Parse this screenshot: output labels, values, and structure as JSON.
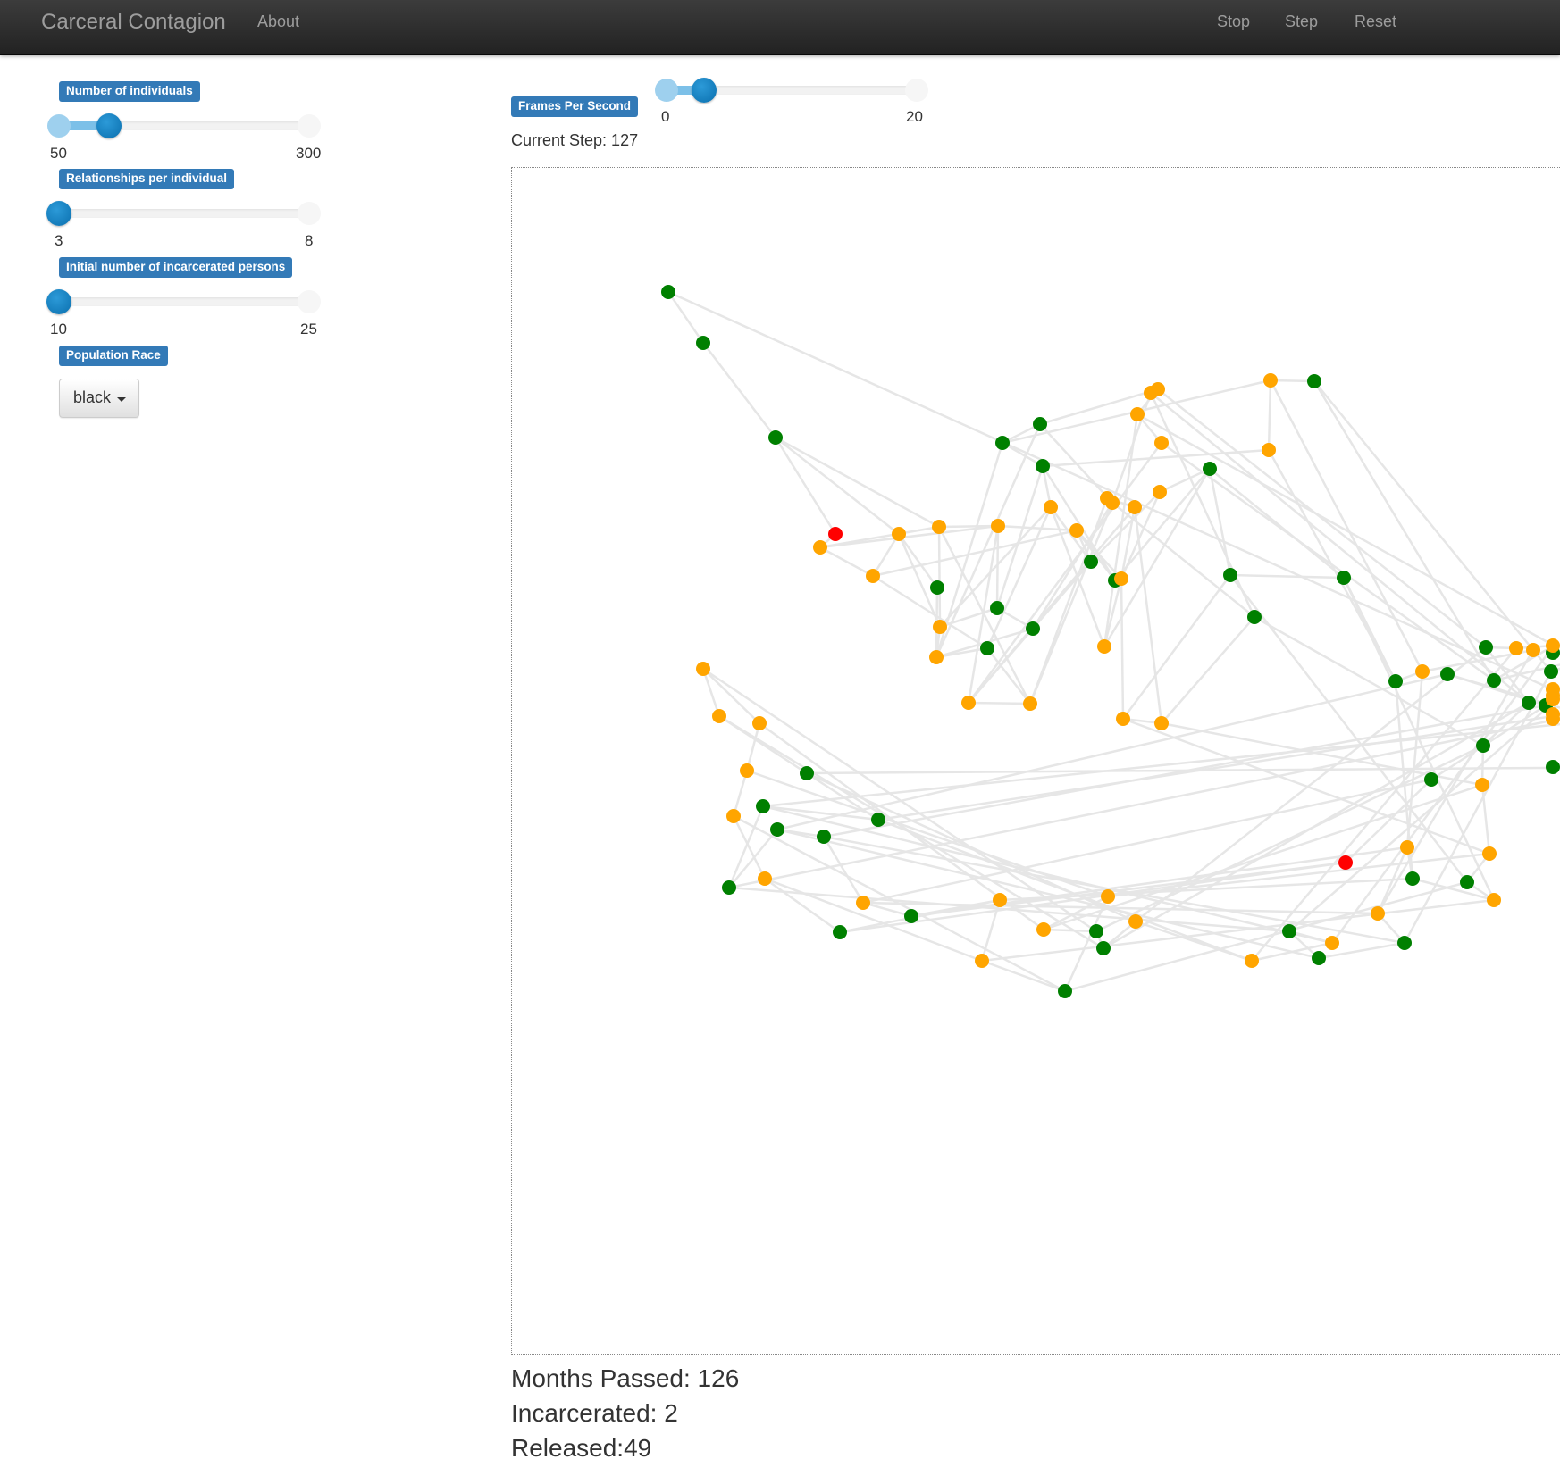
{
  "navbar": {
    "brand": "Carceral Contagion",
    "about": "About",
    "stop": "Stop",
    "step": "Step",
    "reset": "Reset"
  },
  "controls": {
    "individuals": {
      "label": "Number of individuals",
      "min": "50",
      "max": "300",
      "value": 100
    },
    "relationships": {
      "label": "Relationships per individual",
      "min": "3",
      "max": "8",
      "value": 3
    },
    "incarcerated": {
      "label": "Initial number of incarcerated persons",
      "min": "10",
      "max": "25",
      "value": 10
    },
    "race": {
      "label": "Population Race",
      "selected": "black"
    },
    "fps": {
      "label": "Frames Per Second",
      "min": "0",
      "max": "20",
      "value": 3
    }
  },
  "status": {
    "current_step": "Current Step: 127",
    "months_passed": "Months Passed: 126",
    "incarcerated": "Incarcerated: 2",
    "released": "Released:49"
  },
  "network": {
    "colors": {
      "never": "#008000",
      "released": "#ffa500",
      "incarcerated": "#ff0000",
      "edge": "#e6e6e6"
    },
    "nodes": [
      {
        "id": "n1",
        "s": "never"
      },
      {
        "id": "n2",
        "s": "never"
      },
      {
        "id": "n3",
        "s": "never"
      },
      {
        "id": "n4",
        "s": "incarcerated"
      },
      {
        "id": "n5",
        "s": "released"
      },
      {
        "id": "n6",
        "s": "released"
      },
      {
        "id": "n7",
        "s": "released"
      },
      {
        "id": "n8",
        "s": "released"
      },
      {
        "id": "n9",
        "s": "never"
      },
      {
        "id": "n10",
        "s": "released"
      },
      {
        "id": "n11",
        "s": "released"
      },
      {
        "id": "n12",
        "s": "never"
      },
      {
        "id": "n13",
        "s": "never"
      },
      {
        "id": "n14",
        "s": "released"
      },
      {
        "id": "n15",
        "s": "never"
      },
      {
        "id": "n16",
        "s": "released"
      },
      {
        "id": "n17",
        "s": "released"
      },
      {
        "id": "n18",
        "s": "never"
      },
      {
        "id": "n19",
        "s": "released"
      },
      {
        "id": "n20",
        "s": "never"
      },
      {
        "id": "n21",
        "s": "released"
      },
      {
        "id": "n22",
        "s": "never"
      },
      {
        "id": "n23",
        "s": "never"
      },
      {
        "id": "n24",
        "s": "never"
      },
      {
        "id": "n25",
        "s": "released"
      },
      {
        "id": "n26",
        "s": "released"
      },
      {
        "id": "n27",
        "s": "released"
      },
      {
        "id": "n28",
        "s": "released"
      },
      {
        "id": "n29",
        "s": "released"
      },
      {
        "id": "n30",
        "s": "released"
      },
      {
        "id": "n31",
        "s": "never"
      },
      {
        "id": "n32",
        "s": "released"
      },
      {
        "id": "n33",
        "s": "released"
      },
      {
        "id": "n34",
        "s": "never"
      },
      {
        "id": "n35",
        "s": "released"
      },
      {
        "id": "n36",
        "s": "released"
      },
      {
        "id": "n37",
        "s": "released"
      },
      {
        "id": "n38",
        "s": "released"
      },
      {
        "id": "n39",
        "s": "never"
      },
      {
        "id": "n40",
        "s": "released"
      },
      {
        "id": "n41",
        "s": "released"
      },
      {
        "id": "n42",
        "s": "never"
      },
      {
        "id": "n43",
        "s": "never"
      },
      {
        "id": "n44",
        "s": "never"
      },
      {
        "id": "n45",
        "s": "released"
      },
      {
        "id": "n46",
        "s": "released"
      },
      {
        "id": "n47",
        "s": "never"
      },
      {
        "id": "n48",
        "s": "never"
      },
      {
        "id": "n49",
        "s": "never"
      },
      {
        "id": "n50",
        "s": "released"
      },
      {
        "id": "n51",
        "s": "released"
      },
      {
        "id": "n52",
        "s": "never"
      },
      {
        "id": "n53",
        "s": "never"
      },
      {
        "id": "n54",
        "s": "never"
      },
      {
        "id": "n55",
        "s": "released"
      },
      {
        "id": "n56",
        "s": "released"
      },
      {
        "id": "n57",
        "s": "never"
      },
      {
        "id": "n58",
        "s": "released"
      },
      {
        "id": "n59",
        "s": "never"
      },
      {
        "id": "n60",
        "s": "released"
      },
      {
        "id": "n61",
        "s": "released"
      },
      {
        "id": "n62",
        "s": "never"
      },
      {
        "id": "n63",
        "s": "never"
      },
      {
        "id": "n64",
        "s": "never"
      },
      {
        "id": "n65",
        "s": "released"
      },
      {
        "id": "n66",
        "s": "released"
      },
      {
        "id": "n67",
        "s": "released"
      },
      {
        "id": "n68",
        "s": "never"
      },
      {
        "id": "n69",
        "s": "never"
      },
      {
        "id": "n70",
        "s": "released"
      },
      {
        "id": "n71",
        "s": "released"
      },
      {
        "id": "n72",
        "s": "never"
      },
      {
        "id": "n73",
        "s": "released"
      },
      {
        "id": "n74",
        "s": "released"
      },
      {
        "id": "n75",
        "s": "never"
      },
      {
        "id": "n76",
        "s": "released"
      },
      {
        "id": "n77",
        "s": "never"
      },
      {
        "id": "n78",
        "s": "never"
      },
      {
        "id": "n79",
        "s": "never"
      },
      {
        "id": "n80",
        "s": "never"
      },
      {
        "id": "n81",
        "s": "never"
      },
      {
        "id": "n82",
        "s": "never"
      },
      {
        "id": "n83",
        "s": "released"
      },
      {
        "id": "n84",
        "s": "released"
      },
      {
        "id": "n85",
        "s": "released"
      },
      {
        "id": "n86",
        "s": "released"
      },
      {
        "id": "n87",
        "s": "released"
      },
      {
        "id": "n88",
        "s": "released"
      },
      {
        "id": "n89",
        "s": "never"
      },
      {
        "id": "n90",
        "s": "incarcerated"
      },
      {
        "id": "n91",
        "s": "never"
      },
      {
        "id": "n92",
        "s": "never"
      },
      {
        "id": "n93",
        "s": "never"
      },
      {
        "id": "n94",
        "s": "released"
      },
      {
        "id": "n95",
        "s": "released"
      },
      {
        "id": "n96",
        "s": "released"
      },
      {
        "id": "n97",
        "s": "never"
      },
      {
        "id": "n98",
        "s": "released"
      },
      {
        "id": "n99",
        "s": "released"
      }
    ],
    "edges": [
      [
        "n1",
        "n2"
      ],
      [
        "n2",
        "n3"
      ],
      [
        "n3",
        "n4"
      ],
      [
        "n3",
        "n6"
      ],
      [
        "n3",
        "n8"
      ],
      [
        "n4",
        "n5"
      ],
      [
        "n5",
        "n7"
      ],
      [
        "n5",
        "n10"
      ],
      [
        "n5",
        "n8"
      ],
      [
        "n6",
        "n7"
      ],
      [
        "n6",
        "n11"
      ],
      [
        "n6",
        "n9"
      ],
      [
        "n7",
        "n15"
      ],
      [
        "n7",
        "n19"
      ],
      [
        "n8",
        "n10"
      ],
      [
        "n8",
        "n11"
      ],
      [
        "n8",
        "n16"
      ],
      [
        "n9",
        "n14"
      ],
      [
        "n10",
        "n12"
      ],
      [
        "n10",
        "n17"
      ],
      [
        "n10",
        "n19"
      ],
      [
        "n11",
        "n12"
      ],
      [
        "n11",
        "n14"
      ],
      [
        "n11",
        "n21"
      ],
      [
        "n12",
        "n13"
      ],
      [
        "n12",
        "n22"
      ],
      [
        "n13",
        "n14"
      ],
      [
        "n13",
        "n25"
      ],
      [
        "n14",
        "n15"
      ],
      [
        "n14",
        "n23"
      ],
      [
        "n14",
        "n24"
      ],
      [
        "n15",
        "n16"
      ],
      [
        "n15",
        "n21"
      ],
      [
        "n16",
        "n17"
      ],
      [
        "n16",
        "n26"
      ],
      [
        "n16",
        "n25"
      ],
      [
        "n17",
        "n18"
      ],
      [
        "n17",
        "n27"
      ],
      [
        "n17",
        "n35"
      ],
      [
        "n18",
        "n19"
      ],
      [
        "n18",
        "n21"
      ],
      [
        "n18",
        "n28"
      ],
      [
        "n19",
        "n20"
      ],
      [
        "n19",
        "n29"
      ],
      [
        "n20",
        "n22"
      ],
      [
        "n20",
        "n31"
      ],
      [
        "n21",
        "n22"
      ],
      [
        "n21",
        "n30"
      ],
      [
        "n22",
        "n23"
      ],
      [
        "n22",
        "n32"
      ],
      [
        "n23",
        "n24"
      ],
      [
        "n23",
        "n33"
      ],
      [
        "n24",
        "n37"
      ],
      [
        "n24",
        "n25"
      ],
      [
        "n25",
        "n26"
      ],
      [
        "n25",
        "n38"
      ],
      [
        "n26",
        "n27"
      ],
      [
        "n26",
        "n39"
      ],
      [
        "n27",
        "n40"
      ],
      [
        "n27",
        "n29"
      ],
      [
        "n28",
        "n29"
      ],
      [
        "n28",
        "n31"
      ],
      [
        "n29",
        "n30"
      ],
      [
        "n29",
        "n41"
      ],
      [
        "n30",
        "n31"
      ],
      [
        "n30",
        "n36"
      ],
      [
        "n31",
        "n43"
      ],
      [
        "n31",
        "n42"
      ],
      [
        "n32",
        "n33"
      ],
      [
        "n32",
        "n44"
      ],
      [
        "n33",
        "n34"
      ],
      [
        "n33",
        "n45"
      ],
      [
        "n34",
        "n46"
      ],
      [
        "n34",
        "n49"
      ],
      [
        "n35",
        "n36"
      ],
      [
        "n35",
        "n49"
      ],
      [
        "n36",
        "n37"
      ],
      [
        "n36",
        "n50"
      ],
      [
        "n37",
        "n38"
      ],
      [
        "n37",
        "n52"
      ],
      [
        "n38",
        "n39"
      ],
      [
        "n38",
        "n53"
      ],
      [
        "n39",
        "n40"
      ],
      [
        "n39",
        "n54"
      ],
      [
        "n40",
        "n41"
      ],
      [
        "n40",
        "n55"
      ],
      [
        "n41",
        "n42"
      ],
      [
        "n41",
        "n56"
      ],
      [
        "n42",
        "n43"
      ],
      [
        "n42",
        "n57"
      ],
      [
        "n43",
        "n44"
      ],
      [
        "n43",
        "n58"
      ],
      [
        "n44",
        "n45"
      ],
      [
        "n44",
        "n59"
      ],
      [
        "n45",
        "n46"
      ],
      [
        "n45",
        "n60"
      ],
      [
        "n46",
        "n47"
      ],
      [
        "n46",
        "n61"
      ],
      [
        "n47",
        "n48"
      ],
      [
        "n47",
        "n62"
      ],
      [
        "n48",
        "n49"
      ],
      [
        "n48",
        "n64"
      ],
      [
        "n49",
        "n50"
      ],
      [
        "n50",
        "n51"
      ],
      [
        "n50",
        "n65"
      ],
      [
        "n51",
        "n52"
      ],
      [
        "n51",
        "n66"
      ],
      [
        "n52",
        "n53"
      ],
      [
        "n52",
        "n67"
      ],
      [
        "n53",
        "n54"
      ],
      [
        "n53",
        "n68"
      ],
      [
        "n54",
        "n55"
      ],
      [
        "n54",
        "n69"
      ],
      [
        "n55",
        "n56"
      ],
      [
        "n55",
        "n70"
      ],
      [
        "n56",
        "n57"
      ],
      [
        "n56",
        "n71"
      ],
      [
        "n57",
        "n58"
      ],
      [
        "n57",
        "n72"
      ],
      [
        "n58",
        "n59"
      ],
      [
        "n58",
        "n73"
      ],
      [
        "n59",
        "n60"
      ],
      [
        "n59",
        "n74"
      ],
      [
        "n60",
        "n61"
      ],
      [
        "n60",
        "n75"
      ],
      [
        "n61",
        "n62"
      ],
      [
        "n61",
        "n76"
      ],
      [
        "n62",
        "n63"
      ],
      [
        "n62",
        "n77"
      ],
      [
        "n63",
        "n64"
      ],
      [
        "n63",
        "n78"
      ],
      [
        "n64",
        "n65"
      ],
      [
        "n64",
        "n79"
      ],
      [
        "n65",
        "n66"
      ],
      [
        "n65",
        "n80"
      ],
      [
        "n66",
        "n67"
      ],
      [
        "n66",
        "n81"
      ],
      [
        "n67",
        "n68"
      ],
      [
        "n67",
        "n82"
      ],
      [
        "n68",
        "n69"
      ],
      [
        "n68",
        "n83"
      ],
      [
        "n69",
        "n70"
      ],
      [
        "n69",
        "n84"
      ],
      [
        "n70",
        "n71"
      ],
      [
        "n70",
        "n85"
      ],
      [
        "n71",
        "n72"
      ],
      [
        "n71",
        "n86"
      ],
      [
        "n72",
        "n73"
      ],
      [
        "n72",
        "n87"
      ],
      [
        "n73",
        "n74"
      ],
      [
        "n73",
        "n88"
      ],
      [
        "n74",
        "n75"
      ],
      [
        "n74",
        "n89"
      ],
      [
        "n75",
        "n76"
      ],
      [
        "n75",
        "n90"
      ],
      [
        "n76",
        "n77"
      ],
      [
        "n76",
        "n91"
      ],
      [
        "n77",
        "n78"
      ],
      [
        "n77",
        "n92"
      ],
      [
        "n78",
        "n79"
      ],
      [
        "n78",
        "n93"
      ],
      [
        "n79",
        "n80"
      ],
      [
        "n79",
        "n94"
      ],
      [
        "n80",
        "n81"
      ],
      [
        "n80",
        "n95"
      ],
      [
        "n81",
        "n82"
      ],
      [
        "n81",
        "n96"
      ],
      [
        "n82",
        "n83"
      ],
      [
        "n82",
        "n97"
      ],
      [
        "n83",
        "n84"
      ],
      [
        "n84",
        "n85"
      ],
      [
        "n85",
        "n86"
      ],
      [
        "n86",
        "n87"
      ],
      [
        "n87",
        "n88"
      ],
      [
        "n88",
        "n89"
      ],
      [
        "n89",
        "n90"
      ],
      [
        "n90",
        "n91"
      ],
      [
        "n91",
        "n92"
      ],
      [
        "n92",
        "n93"
      ],
      [
        "n93",
        "n94"
      ],
      [
        "n94",
        "n95"
      ],
      [
        "n95",
        "n96"
      ],
      [
        "n96",
        "n97"
      ],
      [
        "n97",
        "n98"
      ],
      [
        "n98",
        "n99"
      ],
      [
        "n99",
        "n1"
      ]
    ]
  }
}
